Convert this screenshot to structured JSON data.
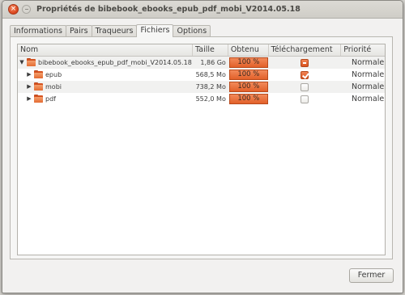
{
  "window": {
    "title": "Propriétés de bibebook_ebooks_epub_pdf_mobi_V2014.05.18",
    "close_glyph": "×"
  },
  "tabs": [
    {
      "label": "Informations",
      "active": false
    },
    {
      "label": "Pairs",
      "active": false
    },
    {
      "label": "Traqueurs",
      "active": false
    },
    {
      "label": "Fichiers",
      "active": true
    },
    {
      "label": "Options",
      "active": false
    }
  ],
  "files_table": {
    "columns": {
      "name": "Nom",
      "size": "Taille",
      "progress": "Obtenu",
      "download": "Téléchargement",
      "priority": "Priorité"
    },
    "rows": [
      {
        "expander": "▼",
        "name": "bibebook_ebooks_epub_pdf_mobi_V2014.05.18",
        "size": "1,86 Go",
        "progress": "100 %",
        "download": "mixed",
        "priority": "Normale"
      },
      {
        "expander": "▶",
        "name": "epub",
        "size": "568,5 Mo",
        "progress": "100 %",
        "download": "checked",
        "priority": "Normale"
      },
      {
        "expander": "▶",
        "name": "mobi",
        "size": "738,2 Mo",
        "progress": "100 %",
        "download": "unchecked",
        "priority": "Normale"
      },
      {
        "expander": "▶",
        "name": "pdf",
        "size": "552,0 Mo",
        "progress": "100 %",
        "download": "unchecked",
        "priority": "Normale"
      }
    ]
  },
  "buttons": {
    "close_label": "Fermer"
  },
  "colors": {
    "accent": "#e2602a",
    "folder": "#e46b32"
  }
}
